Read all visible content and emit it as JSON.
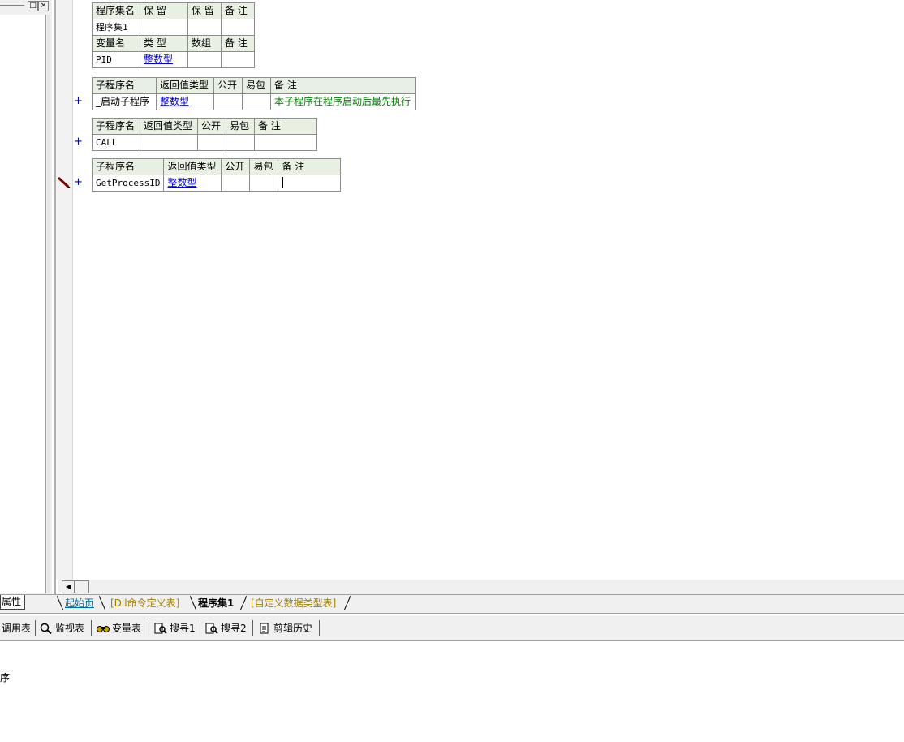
{
  "left_panel": {
    "restore_label": "□",
    "close_label": "×"
  },
  "assembly_table": {
    "header": [
      "程序集名",
      "保 留",
      "保 留",
      "备 注"
    ],
    "row": [
      "程序集1",
      "",
      "",
      ""
    ],
    "var_header": [
      "变量名",
      "类 型",
      "数组",
      "备 注"
    ],
    "var_row": [
      "PID",
      "整数型",
      "",
      ""
    ]
  },
  "subs": [
    {
      "header": [
        "子程序名",
        "返回值类型",
        "公开",
        "易包",
        "备 注"
      ],
      "row": [
        "_启动子程序",
        "整数型",
        "",
        "",
        "本子程序在程序启动后最先执行"
      ],
      "marker": "+"
    },
    {
      "header": [
        "子程序名",
        "返回值类型",
        "公开",
        "易包",
        "备 注"
      ],
      "row": [
        "CALL",
        "",
        "",
        "",
        ""
      ],
      "marker": "+"
    },
    {
      "header": [
        "子程序名",
        "返回值类型",
        "公开",
        "易包",
        "备 注"
      ],
      "row": [
        "GetProcessID",
        "整数型",
        "",
        "",
        ""
      ],
      "marker": "+"
    }
  ],
  "tabs": {
    "properties": "属性",
    "start_page": "起始页",
    "dll_table": "[Dll命令定义表]",
    "assembly": "程序集1",
    "custom_types": "[自定义数据类型表]"
  },
  "toolbar": {
    "call_table": "调用表",
    "watch_table": "监视表",
    "var_table": "变量表",
    "search1": "搜寻1",
    "search2": "搜寻2",
    "clip_history": "剪辑历史"
  },
  "output": {
    "text": "序"
  }
}
